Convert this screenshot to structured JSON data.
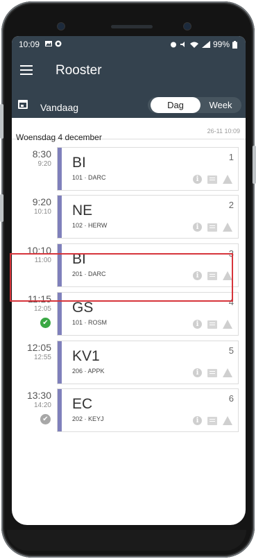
{
  "status_bar": {
    "time": "10:09",
    "battery": "99%"
  },
  "app_bar": {
    "title": "Rooster"
  },
  "sub_bar": {
    "today_label": "Vandaag",
    "view_day": "Dag",
    "view_week": "Week"
  },
  "day": {
    "date_label": "Woensdag 4 december",
    "updated": "26-11 10:09"
  },
  "lessons": [
    {
      "start": "8:30",
      "end": "9:20",
      "subject": "BI",
      "detail": "101 · DARC",
      "hour": "1",
      "status": ""
    },
    {
      "start": "9:20",
      "end": "10:10",
      "subject": "NE",
      "detail": "102 · HERW",
      "hour": "2",
      "status": ""
    },
    {
      "start": "10:10",
      "end": "11:00",
      "subject": "BI",
      "detail": "201 · DARC",
      "hour": "3",
      "status": ""
    },
    {
      "start": "11:15",
      "end": "12:05",
      "subject": "GS",
      "detail": "101 · ROSM",
      "hour": "4",
      "status": "done-green"
    },
    {
      "start": "12:05",
      "end": "12:55",
      "subject": "KV1",
      "detail": "206 · APPK",
      "hour": "5",
      "status": ""
    },
    {
      "start": "13:30",
      "end": "14:20",
      "subject": "EC",
      "detail": "202 · KEYJ",
      "hour": "6",
      "status": "done-grey"
    }
  ],
  "colors": {
    "header": "#34424e",
    "lesson_bar": "#7f80bb",
    "highlight": "#d6343b",
    "check_green": "#3aa844",
    "check_grey": "#a7a7a7"
  }
}
